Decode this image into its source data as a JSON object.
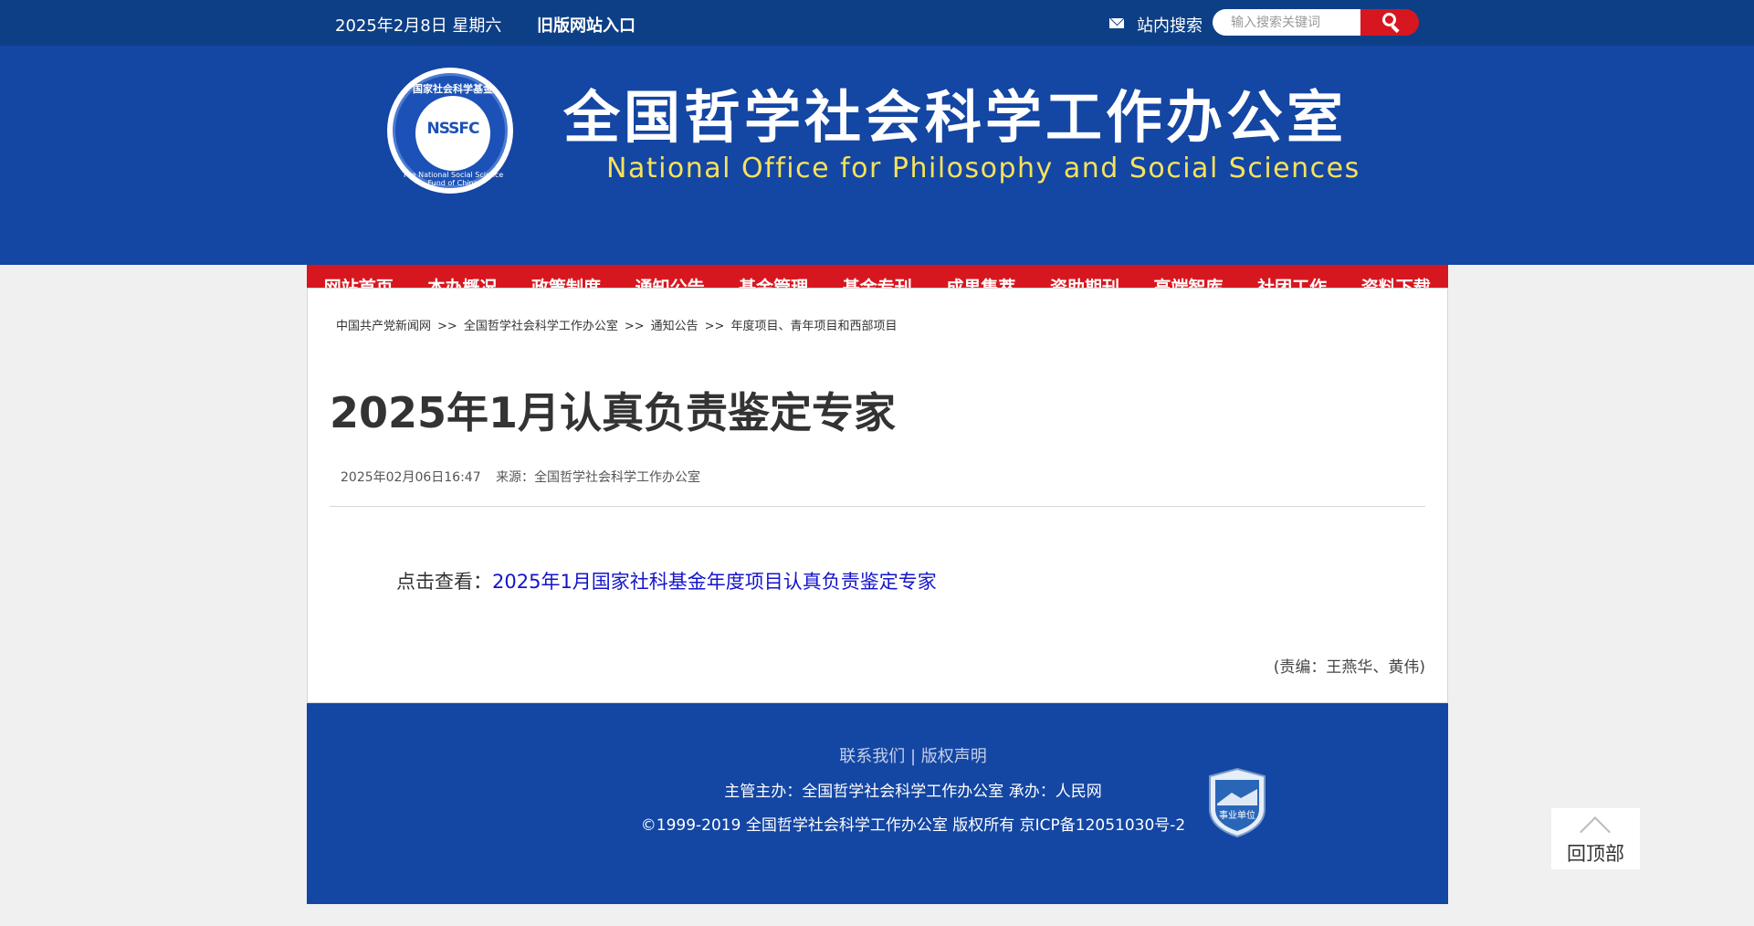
{
  "topbar": {
    "date": "2025年2月8日 星期六",
    "old_site": "旧版网站入口",
    "search_label": "站内搜索",
    "search_placeholder": "输入搜索关键词"
  },
  "header": {
    "logo_text": "NSSFC",
    "logo_ring_top": "国家社会科学基金",
    "logo_ring_bottom": "The National Social Science Fund of China",
    "title_cn": "全国哲学社会科学工作办公室",
    "title_en": "National Office for Philosophy and Social Sciences"
  },
  "nav": [
    "网站首页",
    "本办概况",
    "政策制度",
    "通知公告",
    "基金管理",
    "基金专刊",
    "成果集萃",
    "资助期刊",
    "高端智库",
    "社团工作",
    "资料下载"
  ],
  "breadcrumb": {
    "sep": ">>",
    "items": [
      "中国共产党新闻网",
      "全国哲学社会科学工作办公室",
      "通知公告",
      "年度项目、青年项目和西部项目"
    ]
  },
  "article": {
    "title": "2025年1月认真负责鉴定专家",
    "datetime": "2025年02月06日16:47",
    "source_label": "来源：",
    "source": "全国哲学社会科学工作办公室",
    "prefix": "点击查看：",
    "link_text": "2025年1月国家社科基金年度项目认真负责鉴定专家",
    "editor": "(责编：王燕华、黄伟)"
  },
  "footer": {
    "contact": "联系我们",
    "divider": "|",
    "copyright_link": "版权声明",
    "host": "主管主办：全国哲学社会科学工作办公室 承办：人民网",
    "copy": "©1999-2019 全国哲学社会科学工作办公室 版权所有 京ICP备12051030号-2",
    "badge_text": "事业单位"
  },
  "backtop": "回顶部",
  "colors": {
    "topbar": "#0d3f86",
    "header": "#1446a3",
    "nav": "#d7171f",
    "link": "#1414cc",
    "subtitle": "#f7e25a"
  }
}
